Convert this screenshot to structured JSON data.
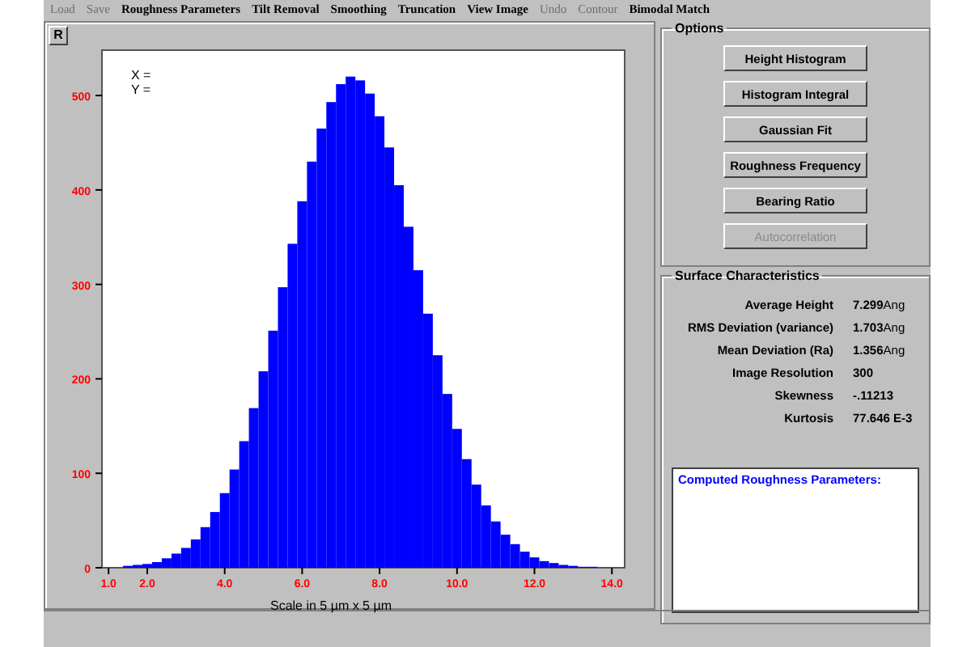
{
  "menu": [
    {
      "label": "Load",
      "disabled": true
    },
    {
      "label": "Save",
      "disabled": true
    },
    {
      "label": "Roughness Parameters",
      "disabled": false
    },
    {
      "label": "Tilt Removal",
      "disabled": false
    },
    {
      "label": "Smoothing",
      "disabled": false
    },
    {
      "label": "Truncation",
      "disabled": false
    },
    {
      "label": "View Image",
      "disabled": false
    },
    {
      "label": "Undo",
      "disabled": true
    },
    {
      "label": "Contour",
      "disabled": true
    },
    {
      "label": "Bimodal Match",
      "disabled": false
    }
  ],
  "plot_panel": {
    "corner_button": "R",
    "cursor_x": "X =",
    "cursor_y": "Y =",
    "chart_data": {
      "type": "bar",
      "xlabel": "Scale in 5 µm x 5 µm",
      "xlim": [
        0.83,
        14.33
      ],
      "ylim": [
        0,
        548
      ],
      "xticks": [
        {
          "value": 1,
          "label": "1.0"
        },
        {
          "value": 2,
          "label": "2.0"
        },
        {
          "value": 4,
          "label": "4.0"
        },
        {
          "value": 6,
          "label": "6.0"
        },
        {
          "value": 8,
          "label": "8.0"
        },
        {
          "value": 10,
          "label": "10.0"
        },
        {
          "value": 12,
          "label": "12.0"
        },
        {
          "value": 14,
          "label": "14.0"
        }
      ],
      "yticks": [
        0,
        100,
        200,
        300,
        400,
        500
      ],
      "x": [
        1.5,
        1.75,
        2.0,
        2.25,
        2.5,
        2.75,
        3.0,
        3.25,
        3.5,
        3.75,
        4.0,
        4.25,
        4.5,
        4.75,
        5.0,
        5.25,
        5.5,
        5.75,
        6.0,
        6.25,
        6.5,
        6.75,
        7.0,
        7.25,
        7.5,
        7.75,
        8.0,
        8.25,
        8.5,
        8.75,
        9.0,
        9.25,
        9.5,
        9.75,
        10.0,
        10.25,
        10.5,
        10.75,
        11.0,
        11.25,
        11.5,
        11.75,
        12.0,
        12.25,
        12.5,
        12.75,
        13.0,
        13.25,
        13.5
      ],
      "series": [
        {
          "color": "#0000ff",
          "values": [
            2,
            3,
            4,
            6,
            10,
            15,
            21,
            30,
            43,
            59,
            79,
            104,
            134,
            169,
            208,
            251,
            297,
            343,
            388,
            430,
            465,
            493,
            512,
            520,
            516,
            502,
            478,
            445,
            405,
            361,
            315,
            269,
            225,
            184,
            147,
            115,
            88,
            66,
            49,
            35,
            25,
            17,
            11,
            7,
            5,
            3,
            2,
            1,
            1
          ]
        }
      ]
    }
  },
  "options": {
    "title": "Options",
    "buttons": [
      {
        "label": "Height Histogram",
        "disabled": false
      },
      {
        "label": "Histogram Integral",
        "disabled": false
      },
      {
        "label": "Gaussian Fit",
        "disabled": false
      },
      {
        "label": "Roughness Frequency",
        "disabled": false
      },
      {
        "label": "Bearing Ratio",
        "disabled": false
      },
      {
        "label": "Autocorrelation",
        "disabled": true
      }
    ]
  },
  "surface_characteristics": {
    "title": "Surface Characteristics",
    "rows": [
      {
        "label": "Average Height",
        "value": "7.299",
        "unit": "Ang"
      },
      {
        "label": "RMS Deviation (variance)",
        "value": "1.703",
        "unit": "Ang"
      },
      {
        "label": "Mean Deviation (Ra)",
        "value": "1.356",
        "unit": "Ang"
      },
      {
        "label": "Image Resolution",
        "value": "300"
      },
      {
        "label": "Skewness",
        "value": "-.11213"
      },
      {
        "label": "Kurtosis",
        "value": "77.646 E-3"
      }
    ],
    "output_box": {
      "value": "Computed Roughness Parameters:"
    }
  }
}
